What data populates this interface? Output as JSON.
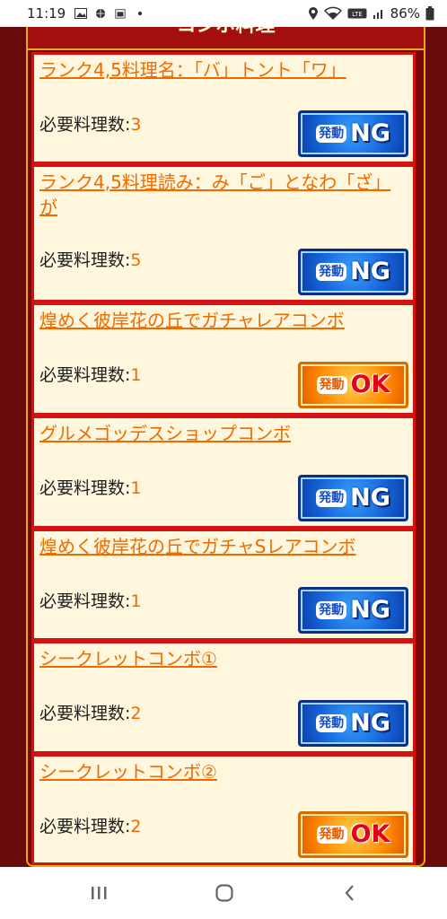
{
  "status_bar": {
    "time": "11:19",
    "battery": "86%",
    "left_icons": [
      "image-icon",
      "ball-icon",
      "calendar-icon",
      "dot-icon"
    ],
    "right_icons": [
      "location-icon",
      "wifi-icon",
      "volte-icon",
      "signal-icon",
      "battery-icon"
    ]
  },
  "header": {
    "title": "コンボ料理"
  },
  "required_label": "必要料理数:",
  "activation_label": "発動",
  "combos": [
    {
      "name": "ランク4,5料理名：「バ」トント「ワ」",
      "required_count": "3",
      "status": "NG"
    },
    {
      "name": "ランク4,5料理読み：み「ご」となわ「ざ」が",
      "required_count": "5",
      "status": "NG"
    },
    {
      "name": "煌めく彼岸花の丘でガチャレアコンボ",
      "required_count": "1",
      "status": "OK"
    },
    {
      "name": "グルメゴッデスショップコンボ",
      "required_count": "1",
      "status": "NG"
    },
    {
      "name": "煌めく彼岸花の丘でガチャSレアコンボ",
      "required_count": "1",
      "status": "NG"
    },
    {
      "name": "シークレットコンボ①",
      "required_count": "2",
      "status": "NG"
    },
    {
      "name": "シークレットコンボ②",
      "required_count": "2",
      "status": "OK"
    }
  ],
  "colors": {
    "background": "#6b0a0a",
    "card_border": "#d41212",
    "card_fill": "#fff7dd",
    "link_orange": "#ef6a00",
    "gold_frame": "#e8a818",
    "ng_blue": "#1563d8",
    "ok_orange": "#ff8a00"
  },
  "nav_bar": {
    "buttons": [
      "recent-apps-icon",
      "home-icon",
      "back-icon"
    ]
  }
}
